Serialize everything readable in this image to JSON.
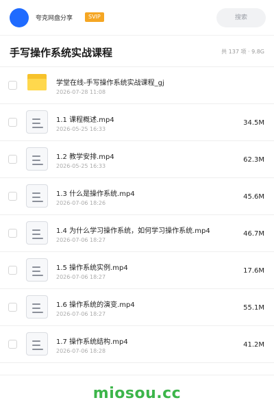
{
  "header": {
    "share_name": "夸克网盘分享",
    "badge": "SVIP",
    "search_placeholder": "搜索"
  },
  "folder": {
    "title": "手写操作系统实战课程",
    "meta": "共 137 项 · 9.8G"
  },
  "files": [
    {
      "type": "folder",
      "name": "学堂在线-手写操作系统实战课程_gj",
      "date": "2026-07-28 11:08",
      "size": ""
    },
    {
      "type": "file",
      "name": "1.1 课程概述.mp4",
      "date": "2026-05-25 16:33",
      "size": "34.5M"
    },
    {
      "type": "file",
      "name": "1.2 教学安排.mp4",
      "date": "2026-05-25 16:33",
      "size": "62.3M"
    },
    {
      "type": "file",
      "name": "1.3 什么是操作系统.mp4",
      "date": "2026-07-06 18:26",
      "size": "45.6M"
    },
    {
      "type": "file",
      "name": "1.4 为什么学习操作系统，如何学习操作系统.mp4",
      "date": "2026-07-06 18:27",
      "size": "46.7M"
    },
    {
      "type": "file",
      "name": "1.5 操作系统实例.mp4",
      "date": "2026-07-06 18:27",
      "size": "17.6M"
    },
    {
      "type": "file",
      "name": "1.6 操作系统的演变.mp4",
      "date": "2026-07-06 18:27",
      "size": "55.1M"
    },
    {
      "type": "file",
      "name": "1.7 操作系统结构.mp4",
      "date": "2026-07-06 18:28",
      "size": "41.2M"
    }
  ],
  "watermark": "miosou.cc",
  "colors": {
    "accent": "#1f6bff",
    "svip": "#f5a623",
    "folder": "#ffd84d",
    "watermark": "#3cb54a"
  }
}
